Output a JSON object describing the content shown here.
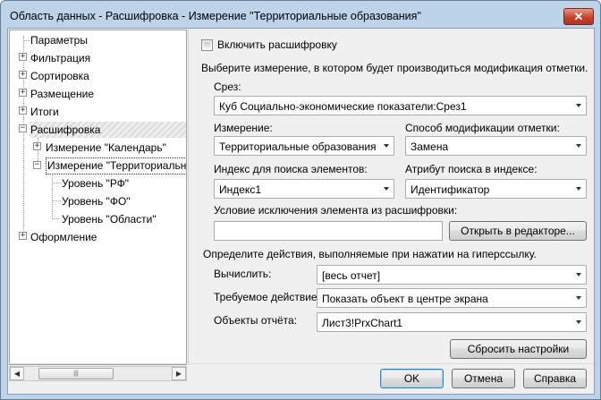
{
  "window": {
    "title": "Область данных - Расшифровка - Измерение \"Территориальные образования\"",
    "close_glyph": "✕"
  },
  "tree": {
    "items": [
      {
        "label": "Параметры"
      },
      {
        "label": "Фильтрация"
      },
      {
        "label": "Сортировка"
      },
      {
        "label": "Размещение"
      },
      {
        "label": "Итоги"
      },
      {
        "label": "Расшифровка"
      },
      {
        "label": "Измерение \"Календарь\""
      },
      {
        "label": "Измерение \"Территориальные образования\""
      },
      {
        "label": "Уровень \"РФ\""
      },
      {
        "label": "Уровень \"ФО\""
      },
      {
        "label": "Уровень \"Области\""
      },
      {
        "label": "Оформление"
      }
    ],
    "plus": "+",
    "minus": "−",
    "scroll_left": "◀",
    "scroll_right": "▶",
    "scroll_grip": "|||"
  },
  "drill": {
    "enable_label": "Включить расшифровку",
    "choose_dimension_hint": "Выберите измерение, в котором будет производиться модификация отметки.",
    "slice_label": "Срез:",
    "slice_value": "Куб Социально-экономические показатели:Срез1",
    "dimension_label": "Измерение:",
    "dimension_value": "Территориальные образования",
    "mod_method_label": "Способ модификации отметки:",
    "mod_method_value": "Замена",
    "index_label": "Индекс для поиска элементов:",
    "index_value": "Индекс1",
    "attr_label": "Атрибут поиска в индексе:",
    "attr_value": "Идентификатор",
    "exclusion_label": "Условие исключения элемента из расшифровки:",
    "exclusion_value": "",
    "open_editor_button": "Открыть в редакторе..."
  },
  "hyperlink": {
    "hint": "Определите действия, выполняемые при нажатии на гиперссылку.",
    "calc_label": "Вычислить:",
    "calc_value": "[весь отчет]",
    "action_label": "Требуемое действие:",
    "action_value": "Показать объект в центре экрана",
    "objects_label": "Объекты отчёта:",
    "objects_value": "Лист3!PrxChart1",
    "reset_button": "Сбросить настройки"
  },
  "footer": {
    "ok": "OK",
    "cancel": "Отмена",
    "help": "Справка"
  }
}
